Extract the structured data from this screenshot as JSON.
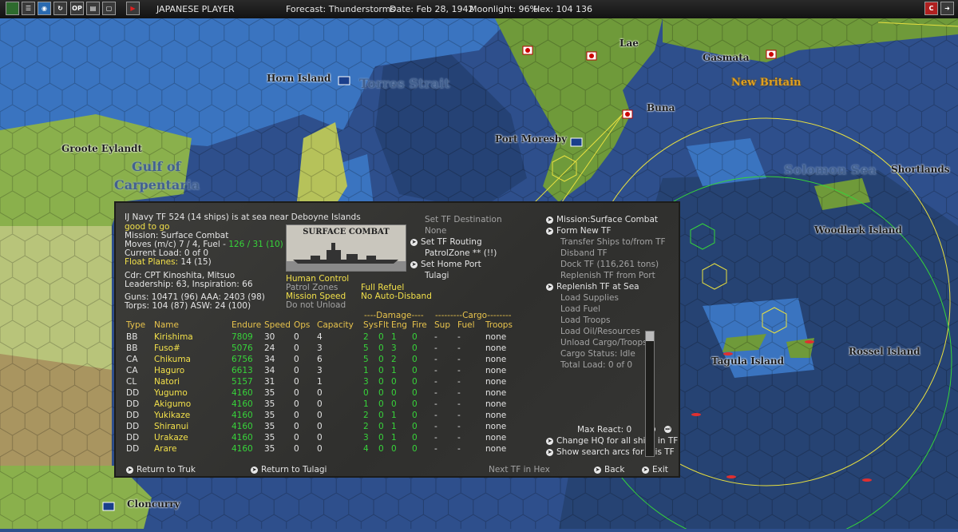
{
  "topbar": {
    "player": "JAPANESE PLAYER",
    "forecast": "Forecast: Thunderstorms",
    "date": "Date: Feb 28, 1942",
    "moonlight": "Moonlight: 96%",
    "hex": "Hex: 104 136",
    "btn_op": "OP",
    "btn_c": "C"
  },
  "map_labels": {
    "lae": "Lae",
    "gasmata": "Gasmata",
    "new_britain": "New Britain",
    "horn_island": "Horn Island",
    "torres_strait": "Torres Strait",
    "buna": "Buna",
    "port_moresby": "Port Moresby",
    "groote_eylandt": "Groote Eylandt",
    "gulf_of": "Gulf of",
    "carpentaria": "Carpentaria",
    "solomon_sea": "Solomon Sea",
    "shortlands": "Shortlands",
    "woodlark_island": "Woodlark Island",
    "tagula_island": "Tagula Island",
    "rossel_island": "Rossel Island",
    "cloncurry": "Cloncurry"
  },
  "panel": {
    "header": "IJ Navy TF 524 (14 ships) is at sea near Deboyne Islands",
    "status": "good to go",
    "mission": "Mission: Surface Combat",
    "moves_label": "Moves (m/c) 7 / 4, Fuel - ",
    "fuel_value": "126 / 31 (10)",
    "current_load": "Current Load: 0 of 0",
    "float_planes_label": "Float Planes: ",
    "float_planes_value": "14 (15)",
    "commander": "Cdr: CPT  Kinoshita, Mitsuo",
    "leadership": "Leadership: 63, Inspiration: 66",
    "guns": "Guns: 10471 (96)  AAA: 2403 (98)",
    "torps": "Torps: 104 (87)    ASW: 24 (100)",
    "photo_caption": "SURFACE COMBAT",
    "human_control": "Human Control",
    "patrol_zones": "Patrol Zones",
    "mission_speed": "Mission Speed",
    "do_not_unload": "Do not Unload",
    "full_refuel": "Full Refuel",
    "no_auto_disband": "No Auto-Disband",
    "set_tf_destination": "Set TF Destination",
    "none": "None",
    "set_tf_routing": "Set TF Routing",
    "patrol_zone": "PatrolZone ** (!!)",
    "set_home_port": "Set Home Port",
    "tulagi": "Tulagi",
    "right_menu": {
      "mission_surface_combat": "Mission:Surface Combat",
      "form_new_tf": "Form New TF",
      "transfer_ships": "Transfer Ships to/from TF",
      "disband_tf": "Disband TF",
      "dock_tf": "Dock TF (116,261 tons)",
      "replenish_from_port": "Replenish TF from Port",
      "replenish_at_sea": "Replenish TF at Sea",
      "load_supplies": "Load Supplies",
      "load_fuel": "Load Fuel",
      "load_troops": "Load Troops",
      "load_oil": "Load Oil/Resources",
      "unload_cargo": "Unload Cargo/Troops",
      "cargo_status": "Cargo Status: Idle",
      "total_load": "Total Load: 0 of 0"
    },
    "max_react": "Max React:  0",
    "change_hq": "Change HQ for all ships in TF",
    "show_search_arcs": "Show search arcs for this TF",
    "return_to_truk": "Return to Truk",
    "return_to_tulagi": "Return to Tulagi",
    "next_tf": "Next TF in Hex",
    "back": "Back",
    "exit": "Exit",
    "damage_header": "----Damage----",
    "cargo_header": "---------Cargo--------",
    "columns": [
      "Type",
      "Name",
      "Endure",
      "Speed",
      "Ops",
      "Capacity",
      "Sys",
      "Flt",
      "Eng",
      "Fire",
      "Sup",
      "Fuel",
      "Troops"
    ],
    "ships": [
      {
        "type": "BB",
        "name": "Kirishima",
        "endure": "7809",
        "speed": "30",
        "ops": "0",
        "capacity": "4",
        "sys": "2",
        "flt": "0",
        "eng": "1",
        "fire": "0",
        "sup": "-",
        "fuel": "-",
        "troops": "none"
      },
      {
        "type": "BB",
        "name": "Fuso#",
        "endure": "5076",
        "speed": "24",
        "ops": "0",
        "capacity": "3",
        "sys": "5",
        "flt": "0",
        "eng": "3",
        "fire": "0",
        "sup": "-",
        "fuel": "-",
        "troops": "none"
      },
      {
        "type": "CA",
        "name": "Chikuma",
        "endure": "6756",
        "speed": "34",
        "ops": "0",
        "capacity": "6",
        "sys": "5",
        "flt": "0",
        "eng": "2",
        "fire": "0",
        "sup": "-",
        "fuel": "-",
        "troops": "none"
      },
      {
        "type": "CA",
        "name": "Haguro",
        "endure": "6613",
        "speed": "34",
        "ops": "0",
        "capacity": "3",
        "sys": "1",
        "flt": "0",
        "eng": "1",
        "fire": "0",
        "sup": "-",
        "fuel": "-",
        "troops": "none"
      },
      {
        "type": "CL",
        "name": "Natori",
        "endure": "5157",
        "speed": "31",
        "ops": "0",
        "capacity": "1",
        "sys": "3",
        "flt": "0",
        "eng": "0",
        "fire": "0",
        "sup": "-",
        "fuel": "-",
        "troops": "none"
      },
      {
        "type": "DD",
        "name": "Yugumo",
        "endure": "4160",
        "speed": "35",
        "ops": "0",
        "capacity": "0",
        "sys": "0",
        "flt": "0",
        "eng": "0",
        "fire": "0",
        "sup": "-",
        "fuel": "-",
        "troops": "none"
      },
      {
        "type": "DD",
        "name": "Akigumo",
        "endure": "4160",
        "speed": "35",
        "ops": "0",
        "capacity": "0",
        "sys": "1",
        "flt": "0",
        "eng": "0",
        "fire": "0",
        "sup": "-",
        "fuel": "-",
        "troops": "none"
      },
      {
        "type": "DD",
        "name": "Yukikaze",
        "endure": "4160",
        "speed": "35",
        "ops": "0",
        "capacity": "0",
        "sys": "2",
        "flt": "0",
        "eng": "1",
        "fire": "0",
        "sup": "-",
        "fuel": "-",
        "troops": "none"
      },
      {
        "type": "DD",
        "name": "Shiranui",
        "endure": "4160",
        "speed": "35",
        "ops": "0",
        "capacity": "0",
        "sys": "2",
        "flt": "0",
        "eng": "1",
        "fire": "0",
        "sup": "-",
        "fuel": "-",
        "troops": "none"
      },
      {
        "type": "DD",
        "name": "Urakaze",
        "endure": "4160",
        "speed": "35",
        "ops": "0",
        "capacity": "0",
        "sys": "3",
        "flt": "0",
        "eng": "1",
        "fire": "0",
        "sup": "-",
        "fuel": "-",
        "troops": "none"
      },
      {
        "type": "DD",
        "name": "Arare",
        "endure": "4160",
        "speed": "35",
        "ops": "0",
        "capacity": "0",
        "sys": "4",
        "flt": "0",
        "eng": "0",
        "fire": "0",
        "sup": "-",
        "fuel": "-",
        "troops": "none"
      }
    ]
  },
  "colors": {
    "sea": "#2e4f8c",
    "deep_sea": "#254275",
    "shallow": "#3a74c0",
    "land": "#8ab04c",
    "desert": "#d8d48a",
    "panel_bg": "#333331",
    "yellow_text": "#f2e04a",
    "green_text": "#37d43a"
  }
}
